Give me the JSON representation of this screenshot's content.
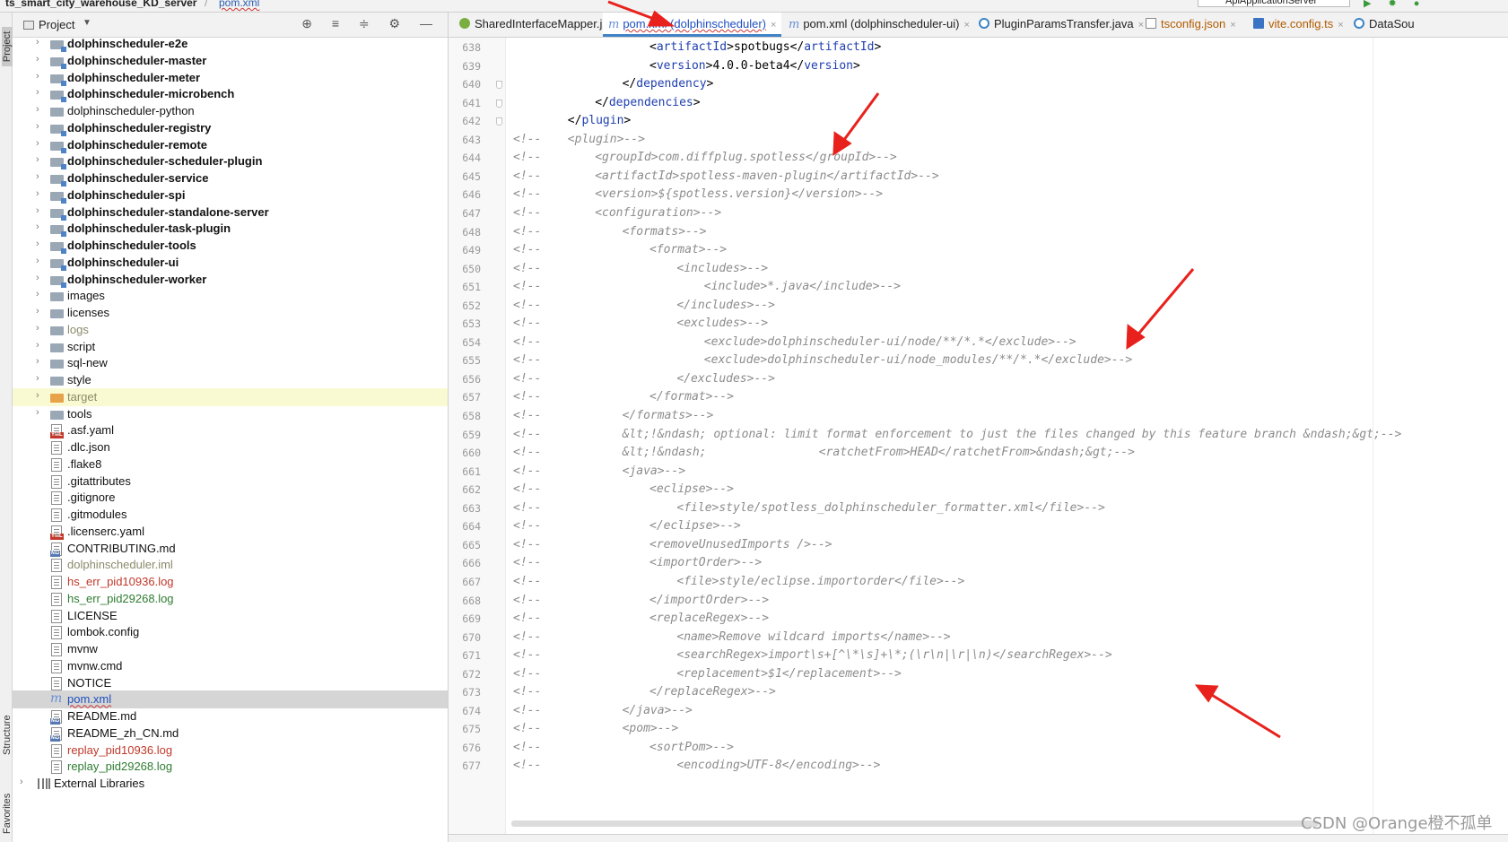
{
  "breadcrumb": {
    "project": "ts_smart_city_warehouse_KD_server",
    "separator": "/",
    "file": "pom.xml"
  },
  "toolbar": {
    "run_config": "ApiApplicationServer",
    "icons": [
      "run-icon",
      "debug-icon",
      "coverage-icon"
    ]
  },
  "left_strip": {
    "project_label": "Project",
    "structure_label": "Structure",
    "favorites_label": "Favorites"
  },
  "project_panel": {
    "title": "Project",
    "header_icons": [
      "locate-icon",
      "expand-all-icon",
      "collapse-all-icon",
      "gear-icon",
      "minimize-icon"
    ],
    "items": [
      {
        "label": "dolphinscheduler-e2e",
        "kind": "module",
        "expandable": true
      },
      {
        "label": "dolphinscheduler-master",
        "kind": "module",
        "expandable": true
      },
      {
        "label": "dolphinscheduler-meter",
        "kind": "module",
        "expandable": true
      },
      {
        "label": "dolphinscheduler-microbench",
        "kind": "module",
        "expandable": true
      },
      {
        "label": "dolphinscheduler-python",
        "kind": "folder",
        "expandable": true
      },
      {
        "label": "dolphinscheduler-registry",
        "kind": "module",
        "expandable": true
      },
      {
        "label": "dolphinscheduler-remote",
        "kind": "module",
        "expandable": true
      },
      {
        "label": "dolphinscheduler-scheduler-plugin",
        "kind": "module",
        "expandable": true
      },
      {
        "label": "dolphinscheduler-service",
        "kind": "module",
        "expandable": true
      },
      {
        "label": "dolphinscheduler-spi",
        "kind": "module",
        "expandable": true
      },
      {
        "label": "dolphinscheduler-standalone-server",
        "kind": "module",
        "expandable": true
      },
      {
        "label": "dolphinscheduler-task-plugin",
        "kind": "module",
        "expandable": true
      },
      {
        "label": "dolphinscheduler-tools",
        "kind": "module",
        "expandable": true
      },
      {
        "label": "dolphinscheduler-ui",
        "kind": "module",
        "expandable": true
      },
      {
        "label": "dolphinscheduler-worker",
        "kind": "module",
        "expandable": true
      },
      {
        "label": "images",
        "kind": "folder",
        "expandable": true
      },
      {
        "label": "licenses",
        "kind": "folder",
        "expandable": true
      },
      {
        "label": "logs",
        "kind": "folder-muted",
        "expandable": true
      },
      {
        "label": "script",
        "kind": "folder",
        "expandable": true
      },
      {
        "label": "sql-new",
        "kind": "folder",
        "expandable": true
      },
      {
        "label": "style",
        "kind": "folder",
        "expandable": true
      },
      {
        "label": "target",
        "kind": "folder-excluded",
        "expandable": true
      },
      {
        "label": "tools",
        "kind": "folder",
        "expandable": true
      },
      {
        "label": ".asf.yaml",
        "kind": "file-yml"
      },
      {
        "label": ".dlc.json",
        "kind": "file"
      },
      {
        "label": ".flake8",
        "kind": "file"
      },
      {
        "label": ".gitattributes",
        "kind": "file"
      },
      {
        "label": ".gitignore",
        "kind": "file"
      },
      {
        "label": ".gitmodules",
        "kind": "file"
      },
      {
        "label": ".licenserc.yaml",
        "kind": "file-yml"
      },
      {
        "label": "CONTRIBUTING.md",
        "kind": "file-md"
      },
      {
        "label": "dolphinscheduler.iml",
        "kind": "file-muted"
      },
      {
        "label": "hs_err_pid10936.log",
        "kind": "file-red"
      },
      {
        "label": "hs_err_pid29268.log",
        "kind": "file-green"
      },
      {
        "label": "LICENSE",
        "kind": "file"
      },
      {
        "label": "lombok.config",
        "kind": "file"
      },
      {
        "label": "mvnw",
        "kind": "file"
      },
      {
        "label": "mvnw.cmd",
        "kind": "file"
      },
      {
        "label": "NOTICE",
        "kind": "file"
      },
      {
        "label": "pom.xml",
        "kind": "file-pom"
      },
      {
        "label": "README.md",
        "kind": "file-md"
      },
      {
        "label": "README_zh_CN.md",
        "kind": "file-md"
      },
      {
        "label": "replay_pid10936.log",
        "kind": "file-red"
      },
      {
        "label": "replay_pid29268.log",
        "kind": "file-green"
      },
      {
        "label": "External Libraries",
        "kind": "libraries",
        "expandable": true
      }
    ]
  },
  "tabs": [
    {
      "label": "SharedInterfaceMapper.java",
      "icon": "java-class-icon"
    },
    {
      "label": "pom.xml (dolphinscheduler)",
      "icon": "maven-icon",
      "active": true
    },
    {
      "label": "pom.xml (dolphinscheduler-ui)",
      "icon": "maven-icon"
    },
    {
      "label": "PluginParamsTransfer.java",
      "icon": "class-icon"
    },
    {
      "label": "tsconfig.json",
      "icon": "json-icon"
    },
    {
      "label": "vite.config.ts",
      "icon": "ts-icon"
    },
    {
      "label": "DataSou",
      "icon": "class-icon"
    }
  ],
  "editor": {
    "lines": [
      {
        "n": "638",
        "text": "<artifactId>spotbugs</artifactId>",
        "commented": false,
        "indent": 20
      },
      {
        "n": "639",
        "text": "<version>4.0.0-beta4</version>",
        "commented": false,
        "indent": 20
      },
      {
        "n": "640",
        "text": "</dependency>",
        "commented": false,
        "indent": 16
      },
      {
        "n": "641",
        "text": "</dependencies>",
        "commented": false,
        "indent": 12
      },
      {
        "n": "642",
        "text": "</plugin>",
        "commented": false,
        "indent": 8
      },
      {
        "n": "643",
        "text": "<plugin>-->",
        "commented": true,
        "indent": 8
      },
      {
        "n": "644",
        "text": "<groupId>com.diffplug.spotless</groupId>-->",
        "commented": true,
        "indent": 12
      },
      {
        "n": "645",
        "text": "<artifactId>spotless-maven-plugin</artifactId>-->",
        "commented": true,
        "indent": 12
      },
      {
        "n": "646",
        "text": "<version>${spotless.version}</version>-->",
        "commented": true,
        "indent": 12
      },
      {
        "n": "647",
        "text": "<configuration>-->",
        "commented": true,
        "indent": 12
      },
      {
        "n": "648",
        "text": "<formats>-->",
        "commented": true,
        "indent": 16
      },
      {
        "n": "649",
        "text": "<format>-->",
        "commented": true,
        "indent": 20
      },
      {
        "n": "650",
        "text": "<includes>-->",
        "commented": true,
        "indent": 24
      },
      {
        "n": "651",
        "text": "<include>*.java</include>-->",
        "commented": true,
        "indent": 28
      },
      {
        "n": "652",
        "text": "</includes>-->",
        "commented": true,
        "indent": 24
      },
      {
        "n": "653",
        "text": "<excludes>-->",
        "commented": true,
        "indent": 24
      },
      {
        "n": "654",
        "text": "<exclude>dolphinscheduler-ui/node/**/*.*</exclude>-->",
        "commented": true,
        "indent": 28
      },
      {
        "n": "655",
        "text": "<exclude>dolphinscheduler-ui/node_modules/**/*.*</exclude>-->",
        "commented": true,
        "indent": 28
      },
      {
        "n": "656",
        "text": "</excludes>-->",
        "commented": true,
        "indent": 24
      },
      {
        "n": "657",
        "text": "</format>-->",
        "commented": true,
        "indent": 20
      },
      {
        "n": "658",
        "text": "</formats>-->",
        "commented": true,
        "indent": 16
      },
      {
        "n": "659",
        "text": "&lt;!&ndash; optional: limit format enforcement to just the files changed by this feature branch &ndash;&gt;-->",
        "commented": true,
        "indent": 16
      },
      {
        "n": "660",
        "text": "&lt;!&ndash;                <ratchetFrom>HEAD</ratchetFrom>&ndash;&gt;-->",
        "commented": true,
        "indent": 16
      },
      {
        "n": "661",
        "text": "<java>-->",
        "commented": true,
        "indent": 16
      },
      {
        "n": "662",
        "text": "<eclipse>-->",
        "commented": true,
        "indent": 20
      },
      {
        "n": "663",
        "text": "<file>style/spotless_dolphinscheduler_formatter.xml</file>-->",
        "commented": true,
        "indent": 24
      },
      {
        "n": "664",
        "text": "</eclipse>-->",
        "commented": true,
        "indent": 20
      },
      {
        "n": "665",
        "text": "<removeUnusedImports />-->",
        "commented": true,
        "indent": 20
      },
      {
        "n": "666",
        "text": "<importOrder>-->",
        "commented": true,
        "indent": 20
      },
      {
        "n": "667",
        "text": "<file>style/eclipse.importorder</file>-->",
        "commented": true,
        "indent": 24
      },
      {
        "n": "668",
        "text": "</importOrder>-->",
        "commented": true,
        "indent": 20
      },
      {
        "n": "669",
        "text": "<replaceRegex>-->",
        "commented": true,
        "indent": 20
      },
      {
        "n": "670",
        "text": "<name>Remove wildcard imports</name>-->",
        "commented": true,
        "indent": 24
      },
      {
        "n": "671",
        "text": "<searchRegex>import\\s+[^\\*\\s]+\\*;(\\r\\n|\\r|\\n)</searchRegex>-->",
        "commented": true,
        "indent": 24
      },
      {
        "n": "672",
        "text": "<replacement>$1</replacement>-->",
        "commented": true,
        "indent": 24
      },
      {
        "n": "673",
        "text": "</replaceRegex>-->",
        "commented": true,
        "indent": 20
      },
      {
        "n": "674",
        "text": "</java>-->",
        "commented": true,
        "indent": 16
      },
      {
        "n": "675",
        "text": "<pom>-->",
        "commented": true,
        "indent": 16
      },
      {
        "n": "676",
        "text": "<sortPom>-->",
        "commented": true,
        "indent": 20
      },
      {
        "n": "677",
        "text": "<encoding>UTF-8</encoding>-->",
        "commented": true,
        "indent": 24
      }
    ],
    "comment_marker": "<!--"
  },
  "watermark": "CSDN @Orange橙不孤单"
}
